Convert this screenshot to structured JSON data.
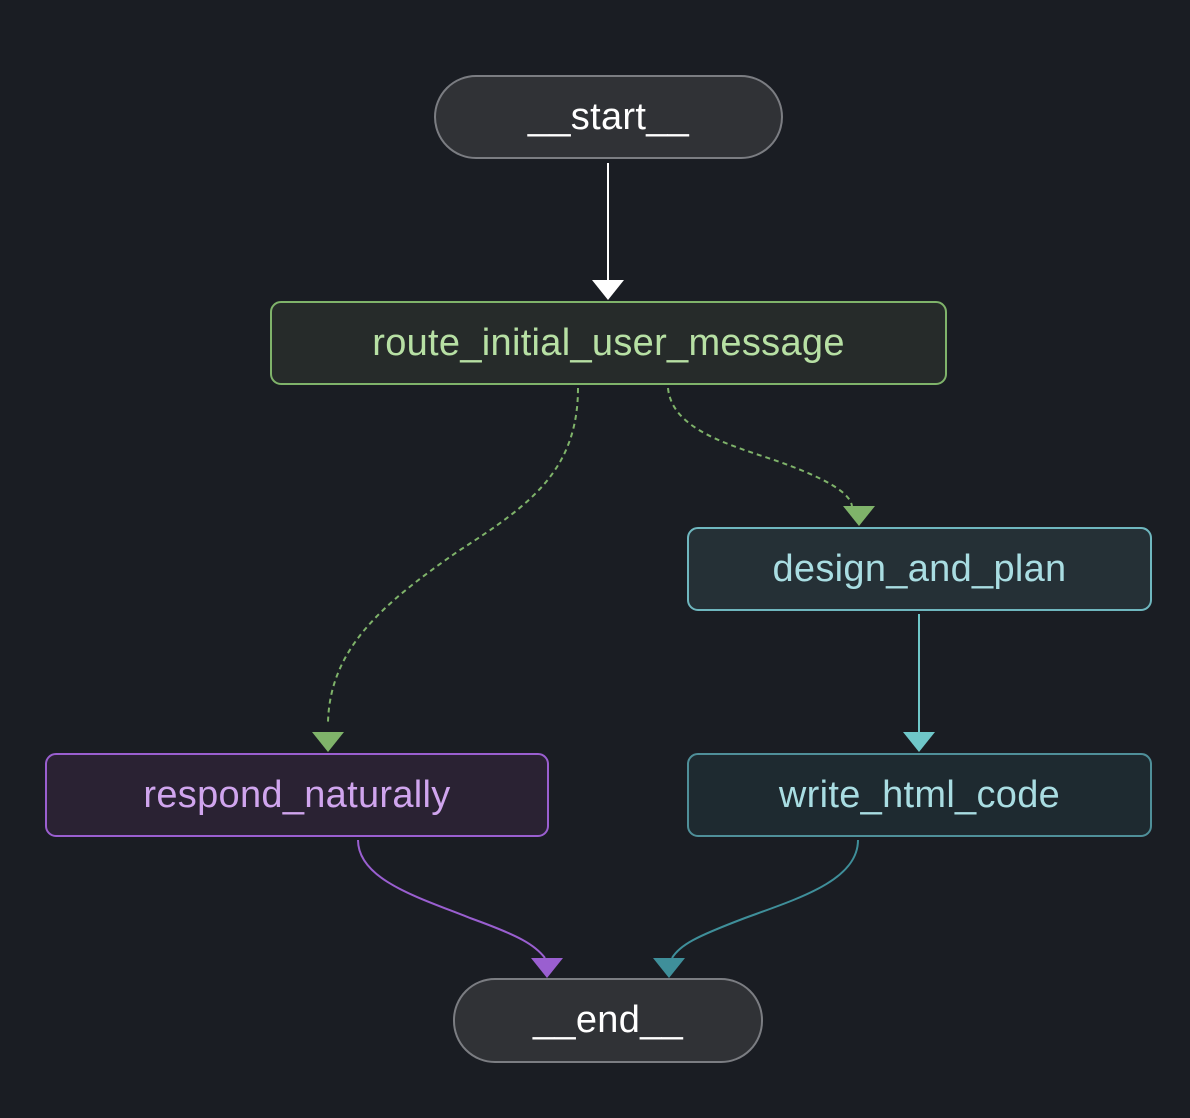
{
  "nodes": {
    "start": "__start__",
    "route": "route_initial_user_message",
    "design": "design_and_plan",
    "respond": "respond_naturally",
    "write": "write_html_code",
    "end": "__end__"
  },
  "edges": [
    {
      "from": "__start__",
      "to": "route_initial_user_message",
      "style": "solid",
      "color": "#ffffff"
    },
    {
      "from": "route_initial_user_message",
      "to": "respond_naturally",
      "style": "dashed",
      "color": "#7fb36a"
    },
    {
      "from": "route_initial_user_message",
      "to": "design_and_plan",
      "style": "dashed",
      "color": "#7fb36a"
    },
    {
      "from": "design_and_plan",
      "to": "write_html_code",
      "style": "solid",
      "color": "#6fc7c9"
    },
    {
      "from": "respond_naturally",
      "to": "__end__",
      "style": "solid",
      "color": "#9a5fd0"
    },
    {
      "from": "write_html_code",
      "to": "__end__",
      "style": "solid",
      "color": "#3f8f9a"
    }
  ],
  "colors": {
    "background": "#1a1d23",
    "start_end": "#303236",
    "route": "#7fb36a",
    "design": "#6fb7bf",
    "respond": "#9a5fd0",
    "write": "#4f8f99"
  }
}
